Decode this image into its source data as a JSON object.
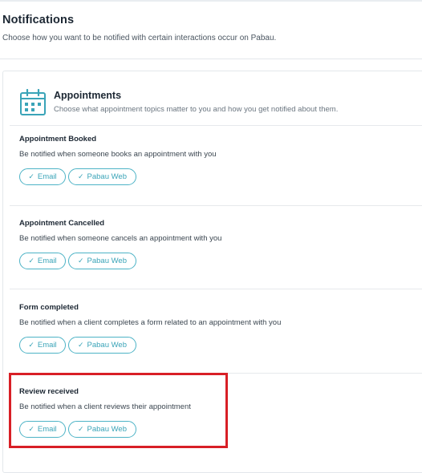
{
  "page": {
    "title": "Notifications",
    "subtitle": "Choose how you want to be notified with certain interactions occur on Pabau."
  },
  "section": {
    "icon": "calendar-icon",
    "title": "Appointments",
    "description": "Choose what appointment topics matter to you and how you get notified about them."
  },
  "topics": [
    {
      "title": "Appointment Booked",
      "description": "Be notified when someone books an appointment with you",
      "channels": [
        {
          "label": "Email",
          "selected": true
        },
        {
          "label": "Pabau Web",
          "selected": true
        }
      ]
    },
    {
      "title": "Appointment Cancelled",
      "description": "Be notified when someone cancels an appointment with you",
      "channels": [
        {
          "label": "Email",
          "selected": true
        },
        {
          "label": "Pabau Web",
          "selected": true
        }
      ]
    },
    {
      "title": "Form completed",
      "description": "Be notified when a client completes a form related to an appointment with you",
      "channels": [
        {
          "label": "Email",
          "selected": true
        },
        {
          "label": "Pabau Web",
          "selected": true
        }
      ]
    },
    {
      "title": "Review received",
      "description": "Be notified when a client reviews their appointment",
      "channels": [
        {
          "label": "Email",
          "selected": true
        },
        {
          "label": "Pabau Web",
          "selected": true
        }
      ]
    }
  ],
  "colors": {
    "accent": "#3aa4b8",
    "chip_border": "#4db3c6",
    "highlight": "#d81f26",
    "title_text": "#1c2733"
  },
  "icons": {
    "check": "check-icon"
  }
}
